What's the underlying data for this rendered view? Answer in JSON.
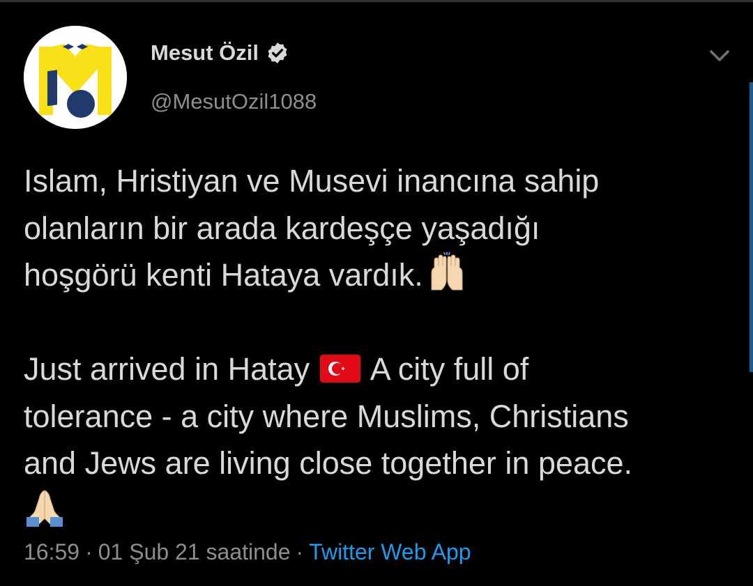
{
  "tweet": {
    "author": {
      "name": "Mesut Özil",
      "handle": "@MesutOzil1088",
      "verified": true,
      "avatar_icon": "m10-logo-icon"
    },
    "text_lines_tr": [
      "Islam, Hristiyan ve Musevi inancına sahip",
      "olanların bir arada kardeşçe yaşadığı",
      "hoşgörü kenti Hataya vardık."
    ],
    "emoji_tr": "raising-hands-emoji",
    "text_en": {
      "line1_before_flag": "Just arrived in Hatay",
      "flag": "turkey-flag-emoji",
      "line1_after_flag": "A city full of",
      "line2": "tolerance - a city where Muslims, Christians",
      "line3": "and Jews are living close together in peace.",
      "emoji": "folded-hands-emoji"
    },
    "meta": {
      "time": "16:59",
      "separator": "·",
      "date": "01 Şub 21 saatinde",
      "source": "Twitter Web App"
    },
    "more_icon": "chevron-down-icon"
  },
  "colors": {
    "background": "#000000",
    "text": "#d9d9d9",
    "secondary": "#8b8f94",
    "link": "#1d9bf0",
    "logo_yellow": "#f7e017",
    "logo_navy": "#1f3a6b"
  }
}
